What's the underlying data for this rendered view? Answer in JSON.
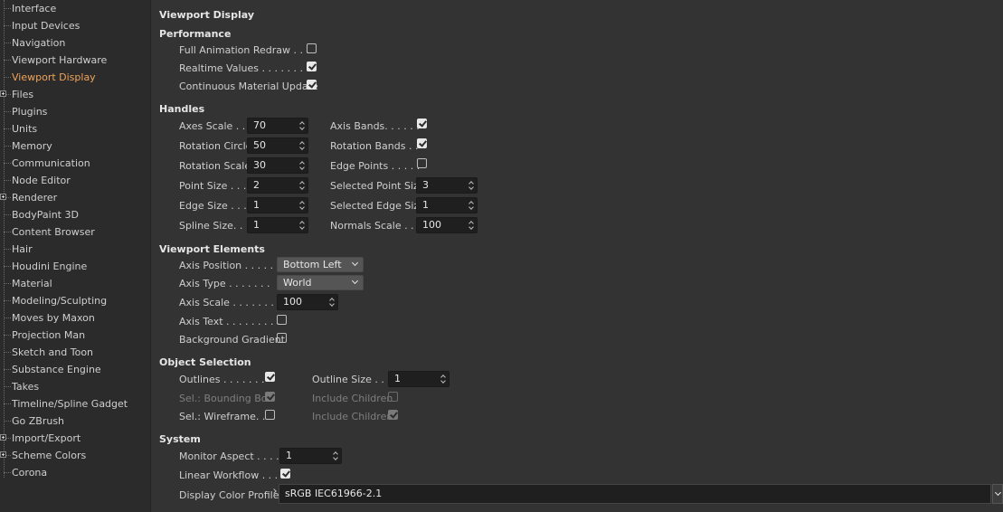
{
  "sidebar": {
    "items": [
      {
        "label": "Interface",
        "expandable": false,
        "selected": false
      },
      {
        "label": "Input Devices",
        "expandable": false,
        "selected": false
      },
      {
        "label": "Navigation",
        "expandable": false,
        "selected": false
      },
      {
        "label": "Viewport Hardware",
        "expandable": false,
        "selected": false
      },
      {
        "label": "Viewport Display",
        "expandable": false,
        "selected": true
      },
      {
        "label": "Files",
        "expandable": true,
        "selected": false
      },
      {
        "label": "Plugins",
        "expandable": false,
        "selected": false
      },
      {
        "label": "Units",
        "expandable": false,
        "selected": false
      },
      {
        "label": "Memory",
        "expandable": false,
        "selected": false
      },
      {
        "label": "Communication",
        "expandable": false,
        "selected": false
      },
      {
        "label": "Node Editor",
        "expandable": false,
        "selected": false
      },
      {
        "label": "Renderer",
        "expandable": true,
        "selected": false
      },
      {
        "label": "BodyPaint 3D",
        "expandable": false,
        "selected": false
      },
      {
        "label": "Content Browser",
        "expandable": false,
        "selected": false
      },
      {
        "label": "Hair",
        "expandable": false,
        "selected": false
      },
      {
        "label": "Houdini Engine",
        "expandable": false,
        "selected": false
      },
      {
        "label": "Material",
        "expandable": false,
        "selected": false
      },
      {
        "label": "Modeling/Sculpting",
        "expandable": false,
        "selected": false
      },
      {
        "label": "Moves by Maxon",
        "expandable": false,
        "selected": false
      },
      {
        "label": "Projection Man",
        "expandable": false,
        "selected": false
      },
      {
        "label": "Sketch and Toon",
        "expandable": false,
        "selected": false
      },
      {
        "label": "Substance Engine",
        "expandable": false,
        "selected": false
      },
      {
        "label": "Takes",
        "expandable": false,
        "selected": false
      },
      {
        "label": "Timeline/Spline Gadget",
        "expandable": false,
        "selected": false
      },
      {
        "label": "Go ZBrush",
        "expandable": false,
        "selected": false
      },
      {
        "label": "Import/Export",
        "expandable": true,
        "selected": false
      },
      {
        "label": "Scheme Colors",
        "expandable": true,
        "selected": false
      },
      {
        "label": "Corona",
        "expandable": false,
        "selected": false
      }
    ]
  },
  "page": {
    "title": "Viewport Display"
  },
  "performance": {
    "heading": "Performance",
    "full_animation_redraw": {
      "label": "Full Animation Redraw . . .",
      "checked": false
    },
    "realtime_values": {
      "label": "Realtime Values . . . . . . . .",
      "checked": true
    },
    "continuous_material_update": {
      "label": "Continuous Material Update",
      "checked": true
    }
  },
  "handles": {
    "heading": "Handles",
    "axes_scale": {
      "label": "Axes Scale . . .",
      "value": "70"
    },
    "rotation_circle": {
      "label": "Rotation Circle",
      "value": "50"
    },
    "rotation_scale": {
      "label": "Rotation Scale",
      "value": "30"
    },
    "point_size": {
      "label": "Point Size . . .",
      "value": "2"
    },
    "edge_size": {
      "label": "Edge Size . . .",
      "value": "1"
    },
    "spline_size": {
      "label": "Spline Size. . .",
      "value": "1"
    },
    "axis_bands": {
      "label": "Axis Bands. . . . . .",
      "checked": true
    },
    "rotation_bands": {
      "label": "Rotation Bands . .",
      "checked": true
    },
    "edge_points": {
      "label": "Edge Points . . . . .",
      "checked": false
    },
    "selected_point_size": {
      "label": "Selected Point Size",
      "value": "3"
    },
    "selected_edge_size": {
      "label": "Selected Edge Size",
      "value": "1"
    },
    "normals_scale": {
      "label": "Normals Scale . . .",
      "value": "100"
    }
  },
  "viewport_elements": {
    "heading": "Viewport Elements",
    "axis_position": {
      "label": "Axis Position . . . . .",
      "value": "Bottom Left"
    },
    "axis_type": {
      "label": "Axis Type . . . . . . .",
      "value": "World"
    },
    "axis_scale": {
      "label": "Axis Scale . . . . . . .",
      "value": "100"
    },
    "axis_text": {
      "label": "Axis Text . . . . . . . . .",
      "checked": false
    },
    "background_gradient": {
      "label": "Background Gradient",
      "checked": false
    }
  },
  "object_selection": {
    "heading": "Object Selection",
    "outlines": {
      "label": "Outlines . . . . . . .",
      "checked": true
    },
    "sel_bounding_box": {
      "label": "Sel.: Bounding Box",
      "checked": true,
      "disabled": true
    },
    "sel_wireframe": {
      "label": "Sel.: Wireframe. .",
      "checked": false
    },
    "outline_size": {
      "label": "Outline Size . . .",
      "value": "1"
    },
    "include_children_1": {
      "label": "Include Children",
      "checked": false,
      "disabled": true
    },
    "include_children_2": {
      "label": "Include Children",
      "checked": true,
      "disabled": true
    }
  },
  "system": {
    "heading": "System",
    "monitor_aspect": {
      "label": "Monitor Aspect . . . .",
      "value": "1"
    },
    "linear_workflow": {
      "label": "Linear Workflow . . . .",
      "checked": true
    },
    "display_color_profile": {
      "label": "Display Color Profile",
      "value": "sRGB IEC61966-2.1"
    }
  },
  "colors": {
    "accent": "#f0a35a",
    "background": "#333333",
    "sidebar": "#2b2b2b"
  }
}
